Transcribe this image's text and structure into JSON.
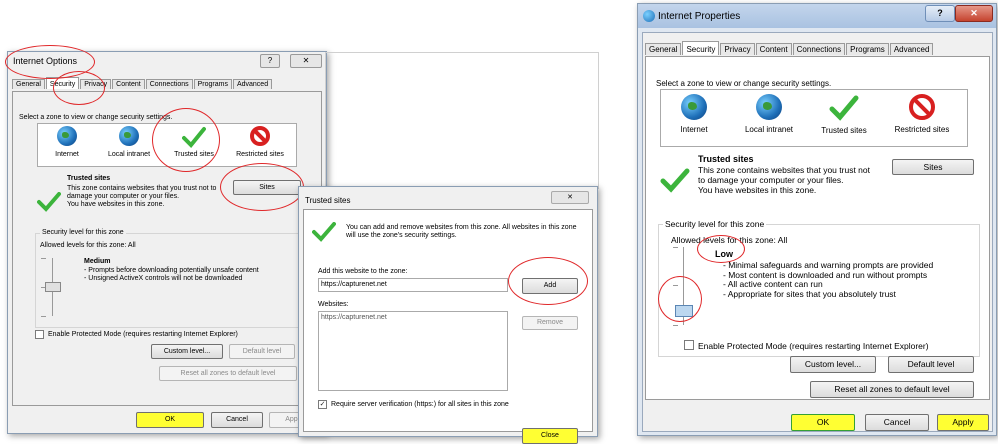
{
  "d1": {
    "title": "Internet Options",
    "tabs": [
      "General",
      "Security",
      "Privacy",
      "Content",
      "Connections",
      "Programs",
      "Advanced"
    ],
    "select_zone": "Select a zone to view or change security settings.",
    "zones": [
      "Internet",
      "Local intranet",
      "Trusted sites",
      "Restricted sites"
    ],
    "zone_title": "Trusted sites",
    "zone_desc": "This zone contains websites that you trust not to damage your computer or your files.\nYou have websites in this zone.",
    "sites_button": "Sites",
    "security_group": "Security level for this zone",
    "allowed_levels": "Allowed levels for this zone: All",
    "level_name": "Medium",
    "level_desc": "- Prompts before downloading potentially unsafe content\n- Unsigned ActiveX controls will not be downloaded",
    "protected_mode": "Enable Protected Mode (requires restarting Internet Explorer)",
    "custom_level": "Custom level...",
    "default_level": "Default level",
    "reset_all": "Reset all zones to default level",
    "ok": "OK",
    "cancel": "Cancel",
    "apply": "Apply"
  },
  "d2": {
    "title": "Trusted sites",
    "info": "You can add and remove websites from this zone. All websites in this zone will use the zone's security settings.",
    "add_label": "Add this website to the zone:",
    "add_value": "https://capturenet.net",
    "add_button": "Add",
    "websites_label": "Websites:",
    "websites": [
      "https://capturenet.net"
    ],
    "remove_button": "Remove",
    "require_https": "Require server verification (https:) for all sites in this zone",
    "close_button": "Close"
  },
  "d3": {
    "title": "Internet Properties",
    "tabs": [
      "General",
      "Security",
      "Privacy",
      "Content",
      "Connections",
      "Programs",
      "Advanced"
    ],
    "select_zone": "Select a zone to view or change security settings.",
    "zones": [
      "Internet",
      "Local intranet",
      "Trusted sites",
      "Restricted sites"
    ],
    "zone_title": "Trusted sites",
    "zone_desc": "This zone contains websites that you trust not to damage your computer or your files.\nYou have websites in this zone.",
    "sites_button": "Sites",
    "security_group": "Security level for this zone",
    "allowed_levels": "Allowed levels for this zone: All",
    "level_name": "Low",
    "level_desc": "- Minimal safeguards and warning prompts are provided\n- Most content is downloaded and run without prompts\n- All active content can run\n- Appropriate for sites that you absolutely trust",
    "protected_mode": "Enable Protected Mode (requires restarting Internet Explorer)",
    "custom_level": "Custom level...",
    "default_level": "Default level",
    "reset_all": "Reset all zones to default level",
    "ok": "OK",
    "cancel": "Cancel",
    "apply": "Apply"
  },
  "colors": {
    "highlight": "#ffff33",
    "annotation": "#e0282a",
    "title_active": "#2b6cb5"
  }
}
